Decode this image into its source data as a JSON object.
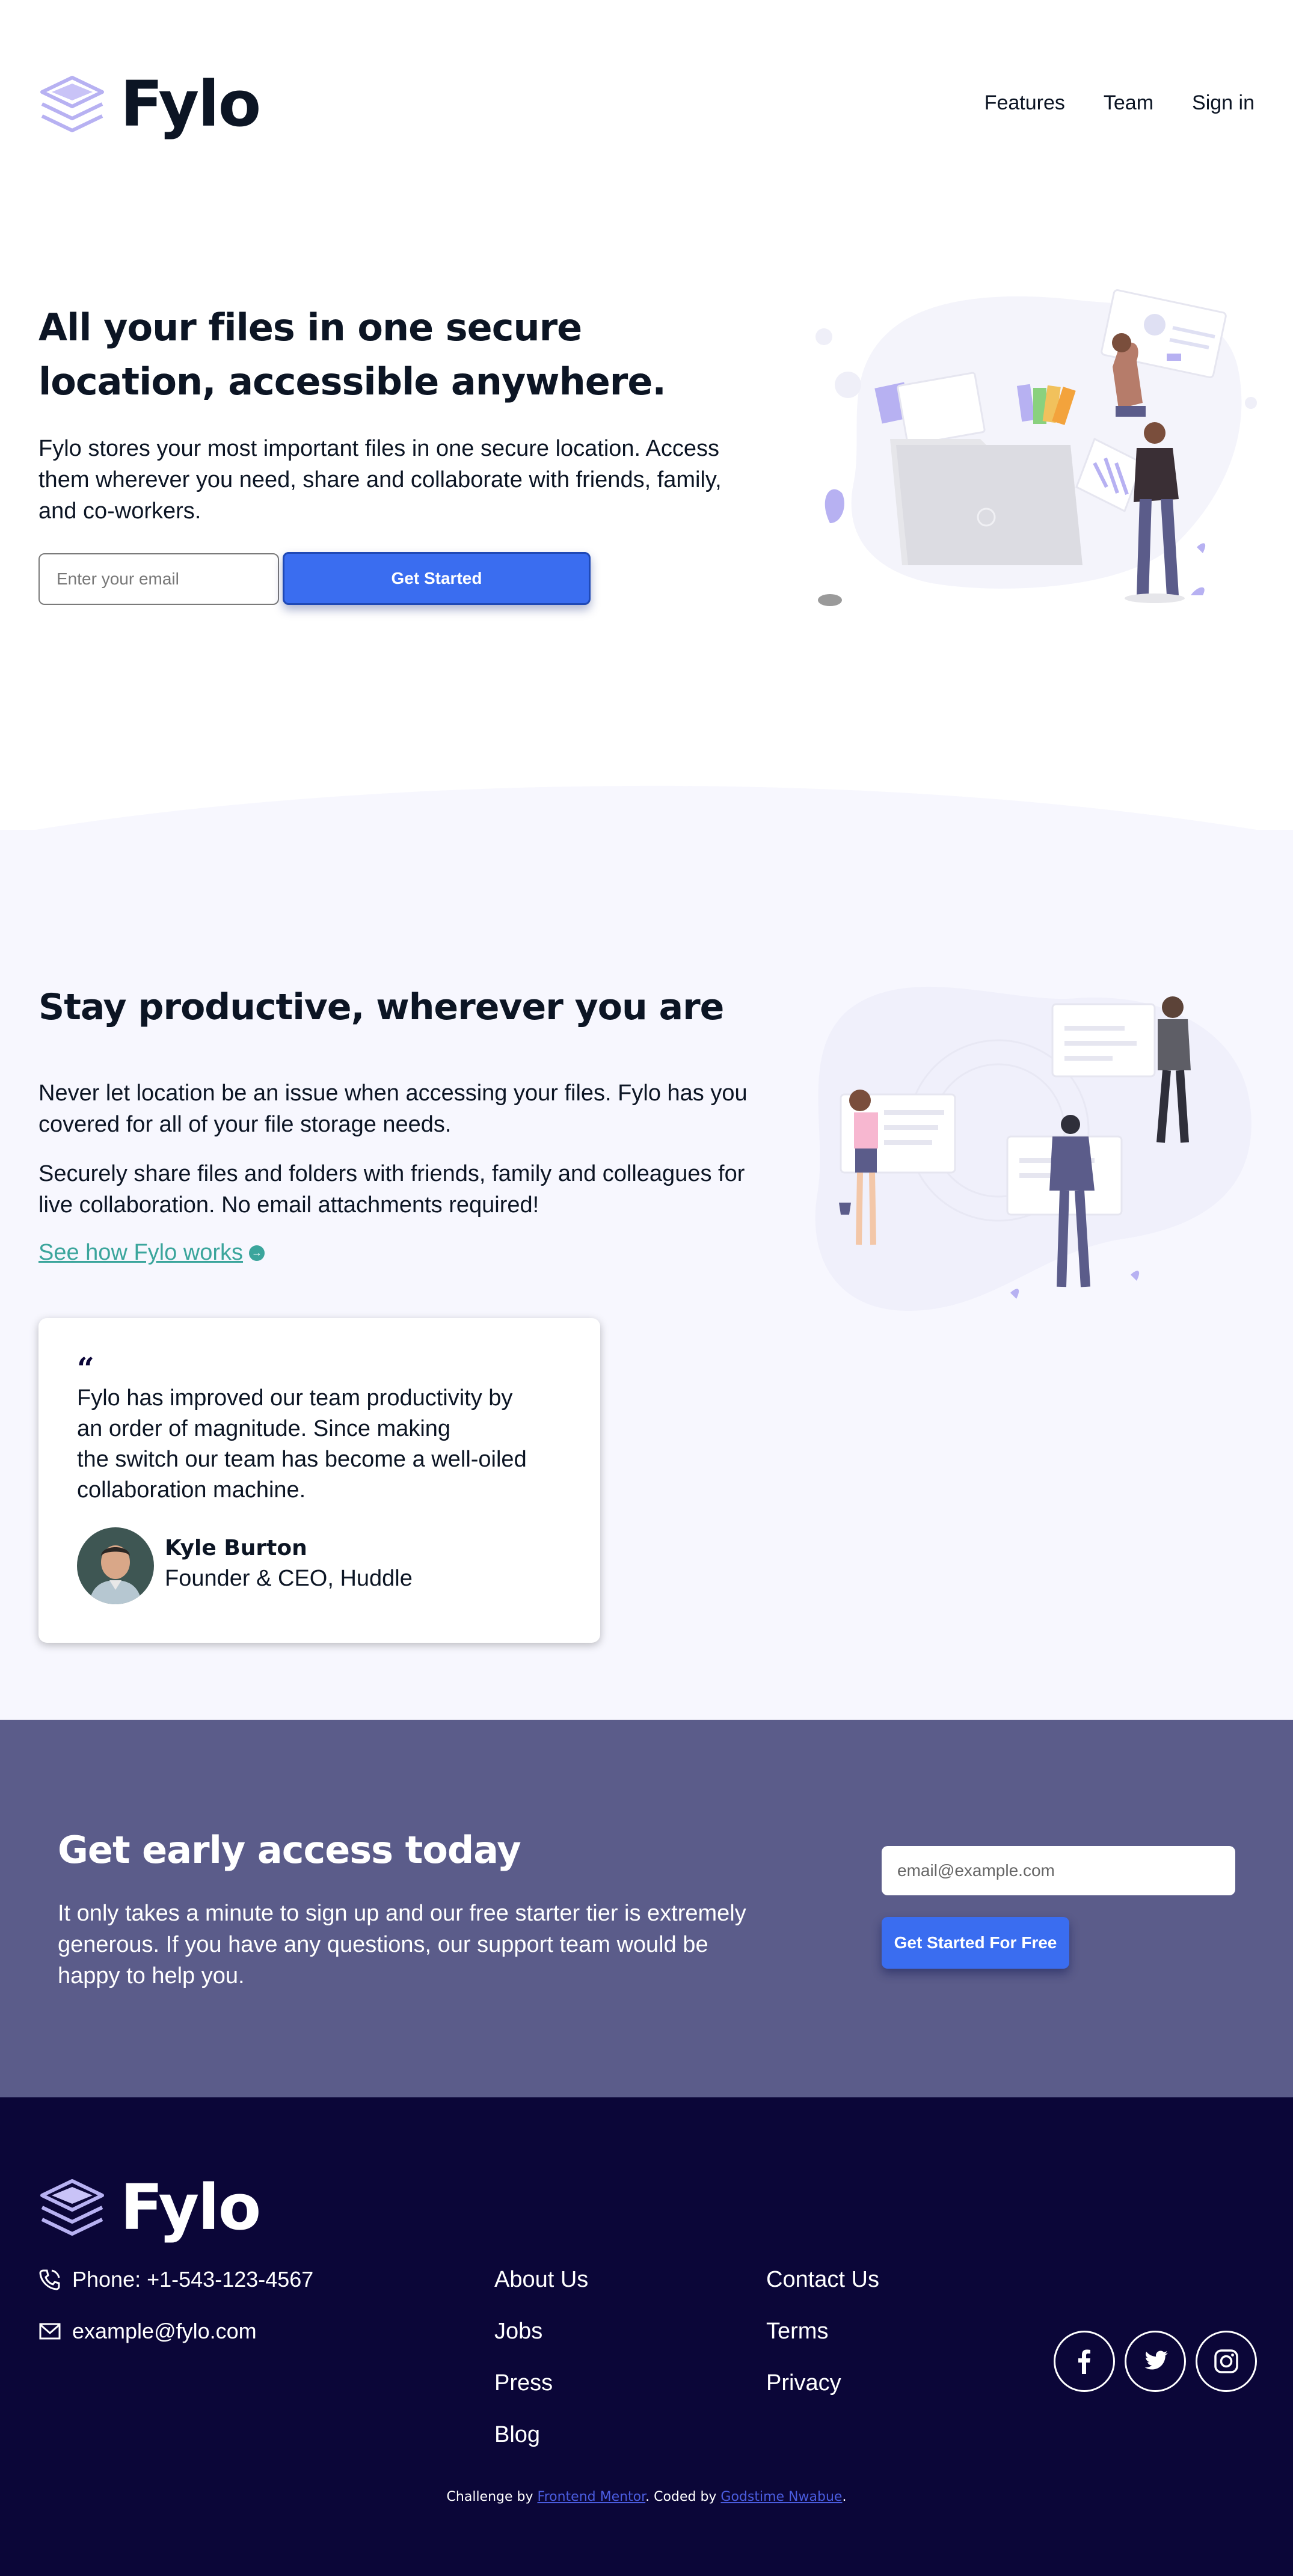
{
  "header": {
    "logo_text": "Fylo",
    "nav": [
      "Features",
      "Team",
      "Sign in"
    ]
  },
  "hero": {
    "title_line1": "All your files in one secure",
    "title_line2": "location, accessible anywhere.",
    "text": "Fylo stores your most important files in one secure location. Access them wherever you need, share and collaborate with friends, family, and co-workers.",
    "email_placeholder": "Enter your email",
    "button_label": "Get Started"
  },
  "productive": {
    "title": "Stay productive, wherever you are",
    "p1": "Never let location be an issue when accessing your files. Fylo has you covered for all of your file storage needs.",
    "p2": "Securely share files and folders with friends, family and colleagues for live collaboration. No email attachments required!",
    "link": "See how Fylo works",
    "testimonial": {
      "quote_mark": "“",
      "line1": "Fylo has improved our team productivity by",
      "line2": "an order of magnitude. Since making",
      "line3": "the switch our team has become a well-oiled",
      "line4": "collaboration machine.",
      "name": "Kyle Burton",
      "role": "Founder & CEO, Huddle"
    }
  },
  "cta": {
    "title": "Get early access today",
    "text": "It only takes a minute to sign up and our free starter tier is extremely generous. If you have any questions, our support team would be happy to help you.",
    "email_placeholder": "email@example.com",
    "button_label": "Get Started For Free"
  },
  "footer": {
    "logo_text": "Fylo",
    "phone": "Phone: +1-543-123-4567",
    "email": "example@fylo.com",
    "col1": [
      "About Us",
      "Jobs",
      "Press",
      "Blog"
    ],
    "col2": [
      "Contact Us",
      "Terms",
      "Privacy"
    ],
    "social_icons": [
      "facebook-icon",
      "twitter-icon",
      "instagram-icon"
    ],
    "attribution": {
      "prefix": "Challenge by ",
      "fm": "Frontend Mentor",
      "middle": ". Coded by ",
      "author": "Godstime Nwabue",
      "suffix": "."
    }
  },
  "colors": {
    "accent_blue": "#3a6df0",
    "link_teal": "#3ba59c",
    "cta_bg": "#5b5c8a",
    "footer_bg": "#0b0638",
    "light_bg": "#f7f7fe"
  }
}
